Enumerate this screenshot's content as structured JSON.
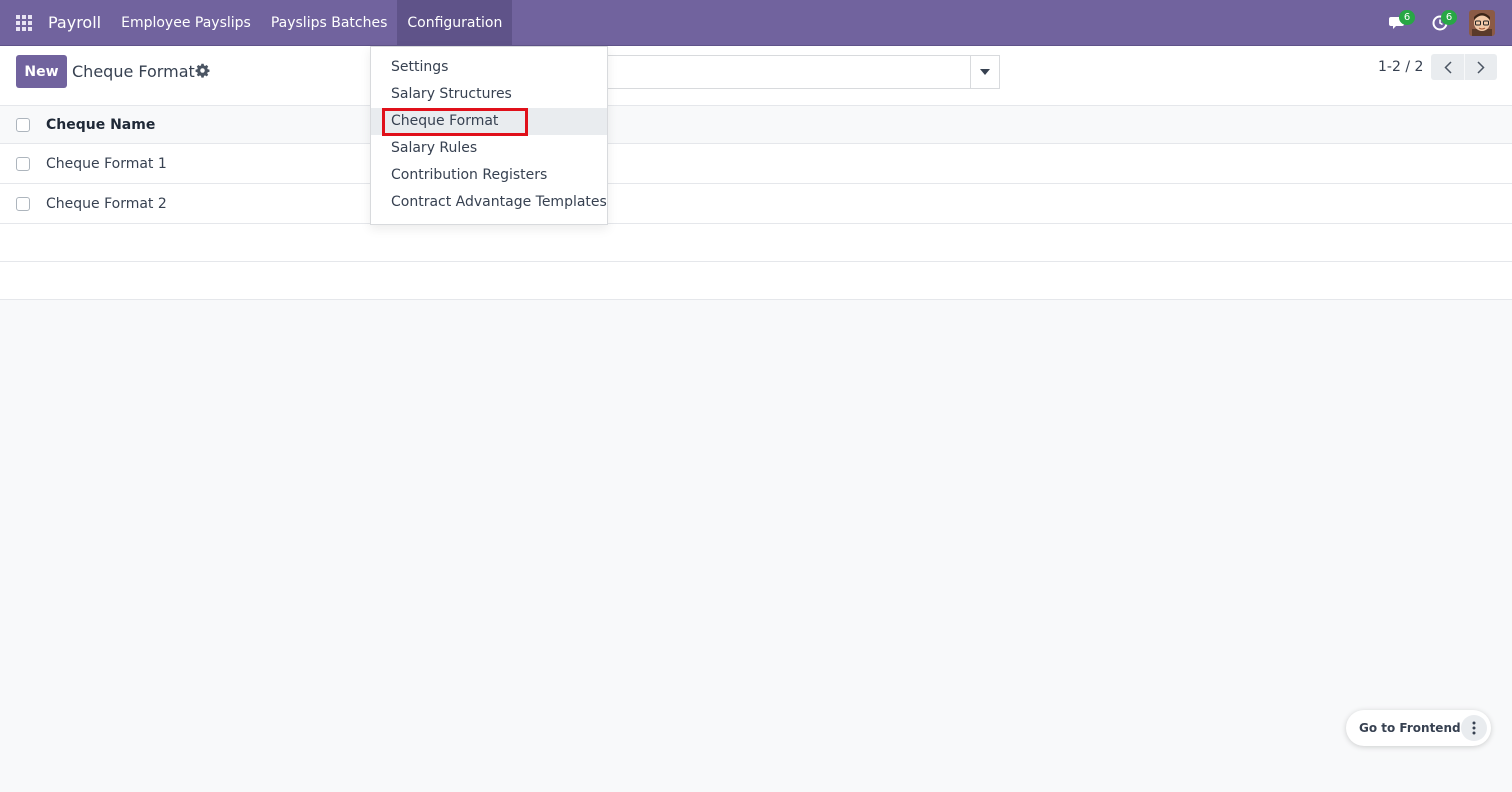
{
  "navbar": {
    "app_name": "Payroll",
    "menu": [
      {
        "label": "Employee Payslips"
      },
      {
        "label": "Payslips Batches"
      },
      {
        "label": "Configuration"
      }
    ],
    "messages_count": "6",
    "activities_count": "6",
    "icons": [
      "apps-grid-icon",
      "chat-icon",
      "clock-icon",
      "user-avatar"
    ]
  },
  "control_panel": {
    "new_label": "New",
    "title": "Cheque Format",
    "search_placeholder": "",
    "pager_value": "1-2 / 2"
  },
  "list": {
    "header": "Cheque Name",
    "rows": [
      {
        "name": "Cheque Format 1"
      },
      {
        "name": "Cheque Format 2"
      }
    ]
  },
  "dropdown": {
    "items": [
      {
        "label": "Settings"
      },
      {
        "label": "Salary Structures"
      },
      {
        "label": "Cheque Format"
      },
      {
        "label": "Salary Rules"
      },
      {
        "label": "Contribution Registers"
      },
      {
        "label": "Contract Advantage Templates"
      }
    ],
    "selected": "Cheque Format"
  },
  "floating": {
    "frontend_label": "Go to Frontend"
  },
  "colors": {
    "brand": "#71639e",
    "badge": "#28a745",
    "highlight": "#e0101a"
  }
}
